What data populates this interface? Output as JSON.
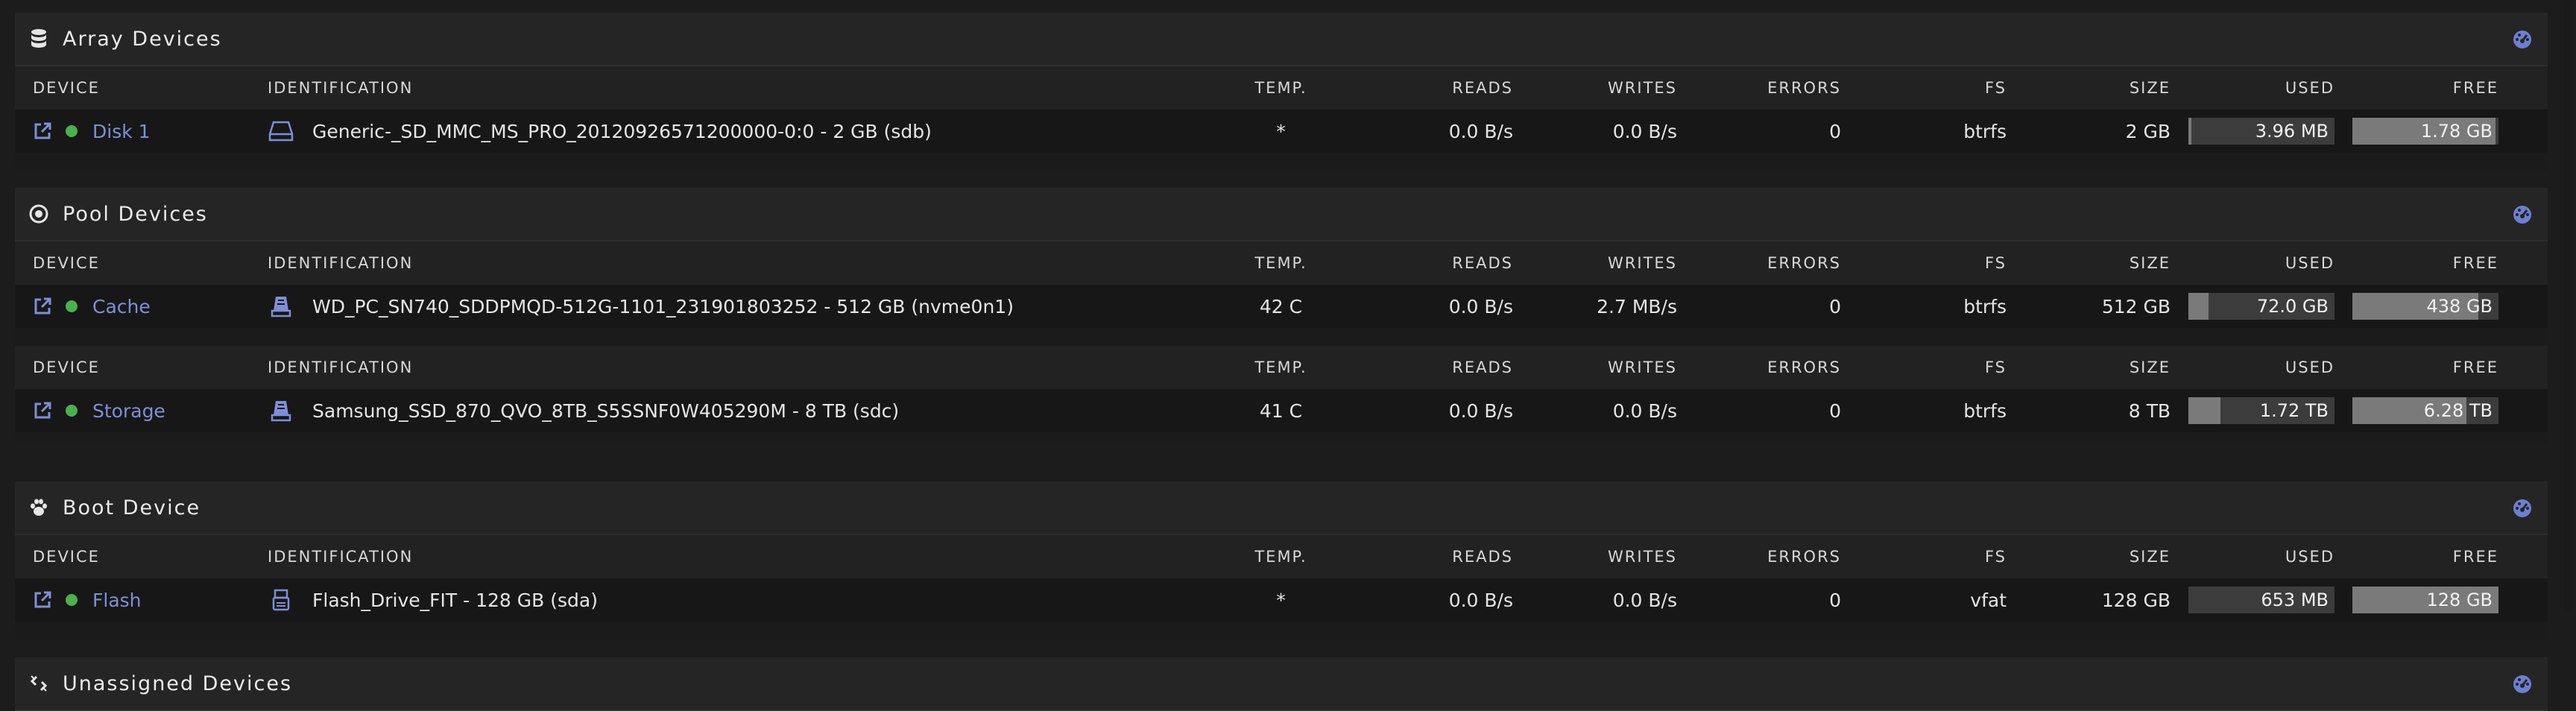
{
  "columns": {
    "device": "DEVICE",
    "identification": "IDENTIFICATION",
    "temp": "TEMP.",
    "reads": "READS",
    "writes": "WRITES",
    "errors": "ERRORS",
    "fs": "FS",
    "size": "SIZE",
    "used": "USED",
    "free": "FREE"
  },
  "colors": {
    "accent": "#7f8fd6",
    "status_ok": "#4caf50"
  },
  "sections": {
    "array": {
      "title": "Array Devices",
      "icon": "database-icon",
      "rows": [
        {
          "device": "Disk 1",
          "identification": "Generic-_SD_MMC_MS_PRO_20120926571200000-0:0 - 2 GB (sdb)",
          "drive_icon": "hdd-icon",
          "temp": "*",
          "reads": "0.0 B/s",
          "writes": "0.0 B/s",
          "errors": "0",
          "fs": "btrfs",
          "size": "2 GB",
          "used": "3.96 MB",
          "used_fraction": 0.02,
          "free": "1.78 GB",
          "free_fraction": 0.98
        }
      ]
    },
    "pool": {
      "title": "Pool Devices",
      "icon": "target-icon",
      "rows": [
        {
          "device": "Cache",
          "identification": "WD_PC_SN740_SDDPMQD-512G-1101_231901803252 - 512 GB (nvme0n1)",
          "drive_icon": "ssd-icon",
          "temp": "42 C",
          "reads": "0.0 B/s",
          "writes": "2.7 MB/s",
          "errors": "0",
          "fs": "btrfs",
          "size": "512 GB",
          "used": "72.0 GB",
          "used_fraction": 0.14,
          "free": "438 GB",
          "free_fraction": 0.86
        },
        {
          "device": "Storage",
          "identification": "Samsung_SSD_870_QVO_8TB_S5SSNF0W405290M - 8 TB (sdc)",
          "drive_icon": "ssd-icon",
          "temp": "41 C",
          "reads": "0.0 B/s",
          "writes": "0.0 B/s",
          "errors": "0",
          "fs": "btrfs",
          "size": "8 TB",
          "used": "1.72 TB",
          "used_fraction": 0.22,
          "free": "6.28 TB",
          "free_fraction": 0.78
        }
      ]
    },
    "boot": {
      "title": "Boot Device",
      "icon": "paw-icon",
      "rows": [
        {
          "device": "Flash",
          "identification": "Flash_Drive_FIT - 128 GB (sda)",
          "drive_icon": "usb-drive-icon",
          "temp": "*",
          "reads": "0.0 B/s",
          "writes": "0.0 B/s",
          "errors": "0",
          "fs": "vfat",
          "size": "128 GB",
          "used": "653 MB",
          "used_fraction": 0.0,
          "free": "128 GB",
          "free_fraction": 1.0
        }
      ]
    },
    "unassigned": {
      "title": "Unassigned Devices",
      "icon": "unlink-icon"
    }
  }
}
